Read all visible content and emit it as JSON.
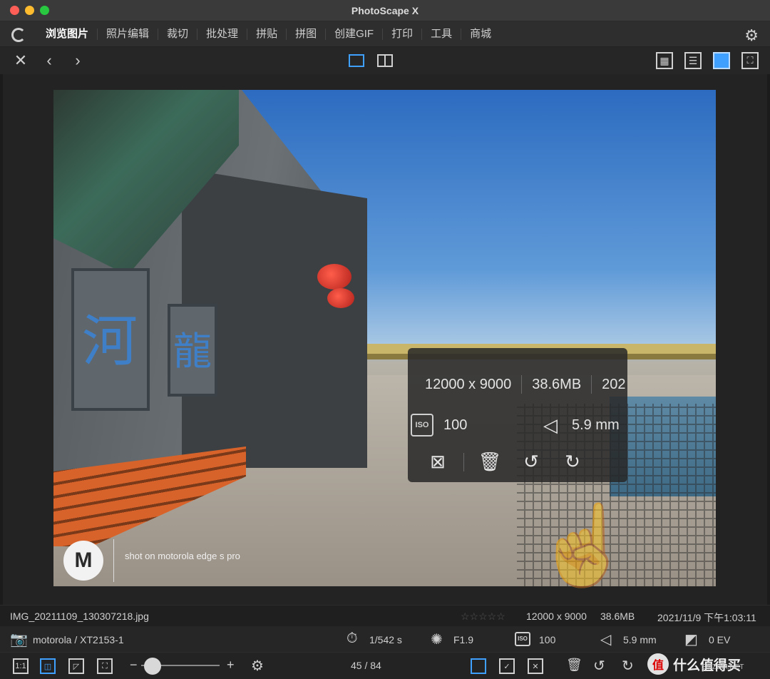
{
  "window": {
    "title": "PhotoScape X"
  },
  "menu": {
    "items": [
      "浏览图片",
      "照片编辑",
      "裁切",
      "批处理",
      "拼贴",
      "拼图",
      "创建GIF",
      "打印",
      "工具",
      "商城"
    ]
  },
  "photo": {
    "watermark_text": "shot on motorola edge s pro",
    "sign_chars": [
      "河",
      "龍"
    ]
  },
  "overlay": {
    "resolution": "12000 x 9000",
    "size": "38.6MB",
    "date_cut": "202",
    "iso_label": "ISO",
    "iso": "100",
    "focal": "5.9 mm"
  },
  "infobar": {
    "filename": "IMG_20211109_130307218.jpg",
    "stars": "☆☆☆☆☆",
    "resolution": "12000 x 9000",
    "size": "38.6MB",
    "datetime": "2021/11/9 下午1:03:11"
  },
  "exif": {
    "camera": "motorola / XT2153-1",
    "shutter": "1/542 s",
    "aperture": "F1.9",
    "iso_label": "ISO",
    "iso": "100",
    "focal": "5.9 mm",
    "ev": "0 EV"
  },
  "bottom": {
    "zoom_1to1": "1:1",
    "minus": "−",
    "plus": "+",
    "counter": "45 / 84"
  },
  "watermark": {
    "site": "什么值得买",
    "small": "SMZDM.NET"
  },
  "colors": {
    "accent": "#3fa0ff",
    "close": "#ff5f57",
    "minimize": "#febc2e",
    "maximize": "#28c840"
  }
}
